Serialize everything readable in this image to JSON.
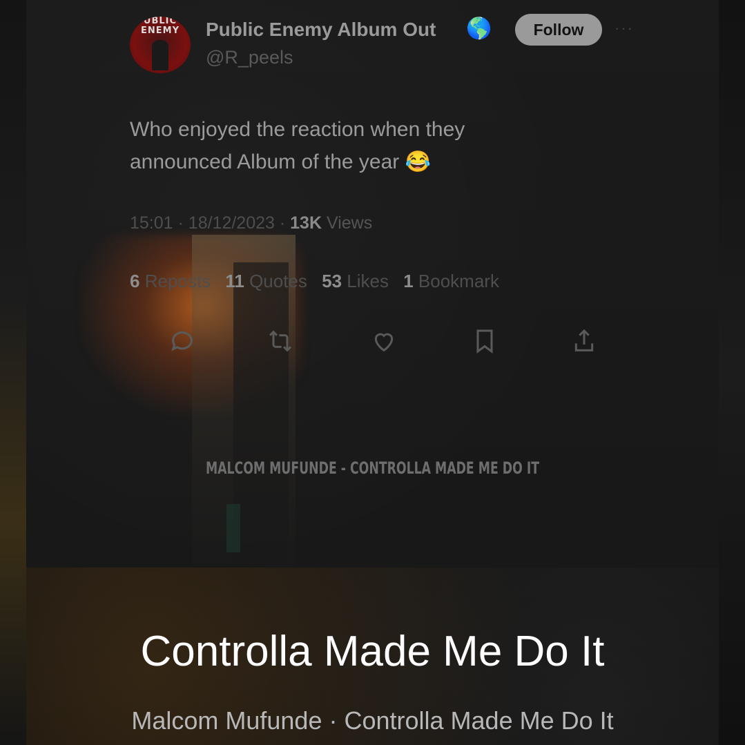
{
  "tweet": {
    "avatar_text": "UBLIC ENEMY",
    "display_name": "Public Enemy Album Out",
    "name_emoji": "🌎",
    "handle": "@R_peels",
    "follow_label": "Follow",
    "more_label": "···",
    "text_line1": "Who enjoyed the reaction when they",
    "text_line2": "announced Album of the year 😂",
    "time": "15:01",
    "date": "18/12/2023",
    "views_count": "13K",
    "views_label": "Views",
    "reposts_count": "6",
    "reposts_label": "Reposts",
    "quotes_count": "11",
    "quotes_label": "Quotes",
    "likes_count": "53",
    "likes_label": "Likes",
    "bookmarks_count": "1",
    "bookmarks_label": "Bookmark",
    "actions": [
      "reply-icon",
      "repost-icon",
      "like-icon",
      "bookmark-icon",
      "share-icon"
    ]
  },
  "watermark": "MALCOM MUFUNDE - CONTROLLA MADE ME DO IT",
  "now_playing": {
    "title": "Controlla Made Me Do It",
    "subtitle": "Malcom Mufunde · Controlla Made Me Do It"
  },
  "colors": {
    "background": "#121212",
    "title_text": "#ffffff",
    "subtitle_text": "#b8b8b8",
    "avatar_red": "#7a1010"
  }
}
